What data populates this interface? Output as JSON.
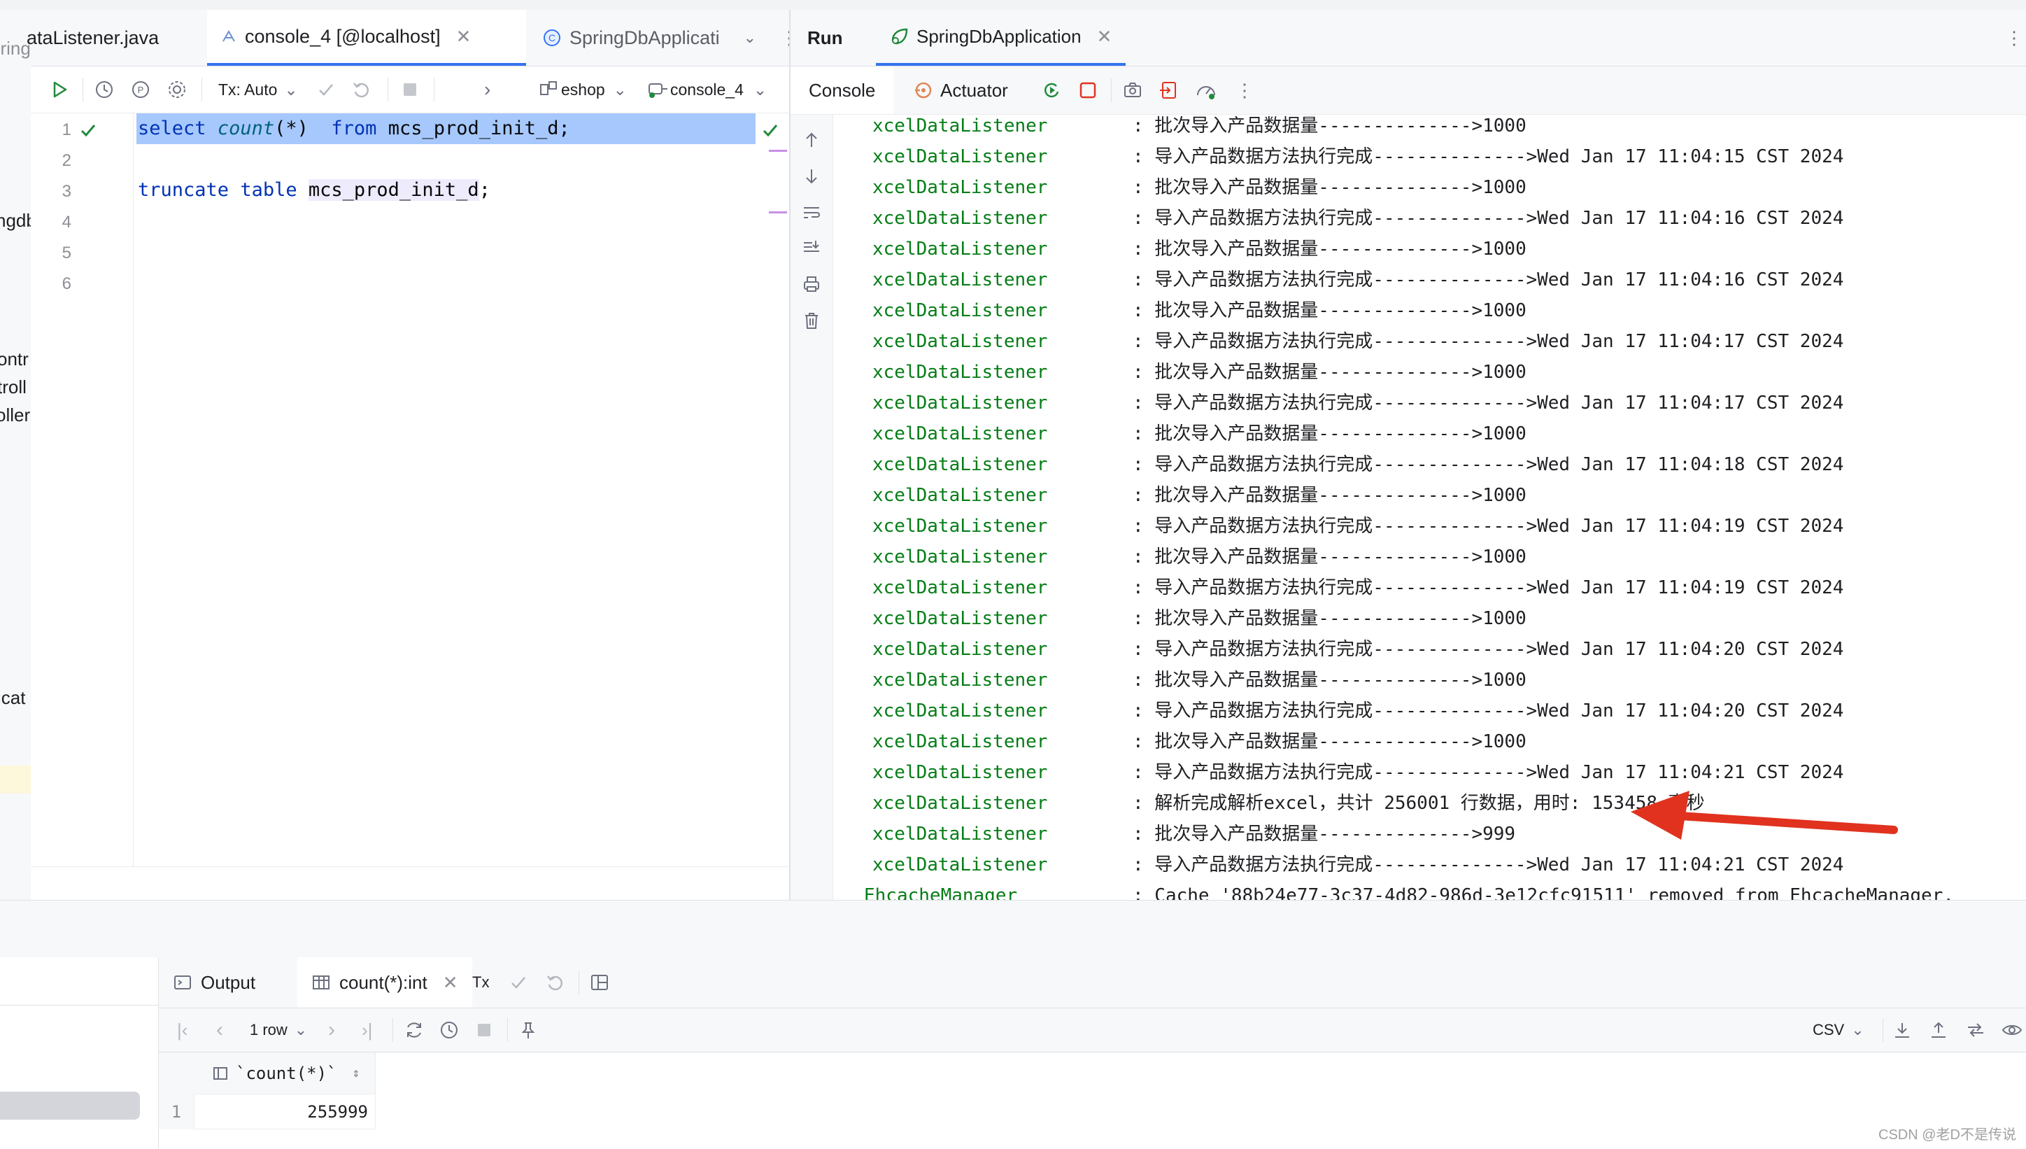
{
  "left_panel": {
    "fragments": [
      "pring",
      "ngdb",
      "ontr",
      "troll",
      "oller",
      "icat"
    ]
  },
  "editor_tabs": [
    {
      "label": "ataListener.java",
      "active": false
    },
    {
      "label": "console_4 [@localhost]",
      "active": true
    },
    {
      "label": "SpringDbApplicati",
      "active": false
    }
  ],
  "editor_toolbar": {
    "tx_mode": "Tx: Auto",
    "schema": "eshop",
    "session": "console_4"
  },
  "editor": {
    "line_numbers": [
      "1",
      "2",
      "3",
      "4",
      "5",
      "6"
    ],
    "line1": {
      "kw1": "select",
      "fn": "count",
      "arg": "(*)",
      "kw2": "from",
      "table": "mcs_prod_init_d",
      "end": ";"
    },
    "line3": {
      "kw1": "truncate",
      "kw2": "table",
      "table": "mcs_prod_init_d",
      "end": ";"
    }
  },
  "run_panel": {
    "title": "Run",
    "config_tab": "SpringDbApplication",
    "tabs": {
      "console": "Console",
      "actuator": "Actuator"
    }
  },
  "console_lines": [
    {
      "name": "xcelDataListener",
      "msg": ": 批次导入产品数据量-------------->1000"
    },
    {
      "name": "xcelDataListener",
      "msg": ": 导入产品数据方法执行完成-------------->Wed Jan 17 11:04:15 CST 2024"
    },
    {
      "name": "xcelDataListener",
      "msg": ": 批次导入产品数据量-------------->1000"
    },
    {
      "name": "xcelDataListener",
      "msg": ": 导入产品数据方法执行完成-------------->Wed Jan 17 11:04:16 CST 2024"
    },
    {
      "name": "xcelDataListener",
      "msg": ": 批次导入产品数据量-------------->1000"
    },
    {
      "name": "xcelDataListener",
      "msg": ": 导入产品数据方法执行完成-------------->Wed Jan 17 11:04:16 CST 2024"
    },
    {
      "name": "xcelDataListener",
      "msg": ": 批次导入产品数据量-------------->1000"
    },
    {
      "name": "xcelDataListener",
      "msg": ": 导入产品数据方法执行完成-------------->Wed Jan 17 11:04:17 CST 2024"
    },
    {
      "name": "xcelDataListener",
      "msg": ": 批次导入产品数据量-------------->1000"
    },
    {
      "name": "xcelDataListener",
      "msg": ": 导入产品数据方法执行完成-------------->Wed Jan 17 11:04:17 CST 2024"
    },
    {
      "name": "xcelDataListener",
      "msg": ": 批次导入产品数据量-------------->1000"
    },
    {
      "name": "xcelDataListener",
      "msg": ": 导入产品数据方法执行完成-------------->Wed Jan 17 11:04:18 CST 2024"
    },
    {
      "name": "xcelDataListener",
      "msg": ": 批次导入产品数据量-------------->1000"
    },
    {
      "name": "xcelDataListener",
      "msg": ": 导入产品数据方法执行完成-------------->Wed Jan 17 11:04:19 CST 2024"
    },
    {
      "name": "xcelDataListener",
      "msg": ": 批次导入产品数据量-------------->1000"
    },
    {
      "name": "xcelDataListener",
      "msg": ": 导入产品数据方法执行完成-------------->Wed Jan 17 11:04:19 CST 2024"
    },
    {
      "name": "xcelDataListener",
      "msg": ": 批次导入产品数据量-------------->1000"
    },
    {
      "name": "xcelDataListener",
      "msg": ": 导入产品数据方法执行完成-------------->Wed Jan 17 11:04:20 CST 2024"
    },
    {
      "name": "xcelDataListener",
      "msg": ": 批次导入产品数据量-------------->1000"
    },
    {
      "name": "xcelDataListener",
      "msg": ": 导入产品数据方法执行完成-------------->Wed Jan 17 11:04:20 CST 2024"
    },
    {
      "name": "xcelDataListener",
      "msg": ": 批次导入产品数据量-------------->1000"
    },
    {
      "name": "xcelDataListener",
      "msg": ": 导入产品数据方法执行完成-------------->Wed Jan 17 11:04:21 CST 2024"
    },
    {
      "name": "xcelDataListener",
      "msg": ": 解析完成解析excel，共计 256001 行数据，用时: 153458 毫秒"
    },
    {
      "name": "xcelDataListener",
      "msg": ": 批次导入产品数据量-------------->999"
    },
    {
      "name": "xcelDataListener",
      "msg": ": 导入产品数据方法执行完成-------------->Wed Jan 17 11:04:21 CST 2024"
    },
    {
      "name": "EhcacheManager",
      "msg": ": Cache '88b24e77-3c37-4d82-986d-3e12cfc91511' removed from EhcacheManager."
    }
  ],
  "output_tabs": {
    "output": "Output",
    "result": "count(*):int",
    "tx": "Tx"
  },
  "grid_toolbar": {
    "rows": "1 row",
    "export_format": "CSV"
  },
  "result_grid": {
    "column": "`count(*)`",
    "row_number": "1",
    "value": "255999"
  },
  "watermark": "CSDN @老D不是传说",
  "colors": {
    "accent": "#3574f0",
    "logger_green": "#067d17",
    "keyword_blue": "#0033b3",
    "selection": "#a6c8fd",
    "arrow_red": "#e0321f"
  }
}
